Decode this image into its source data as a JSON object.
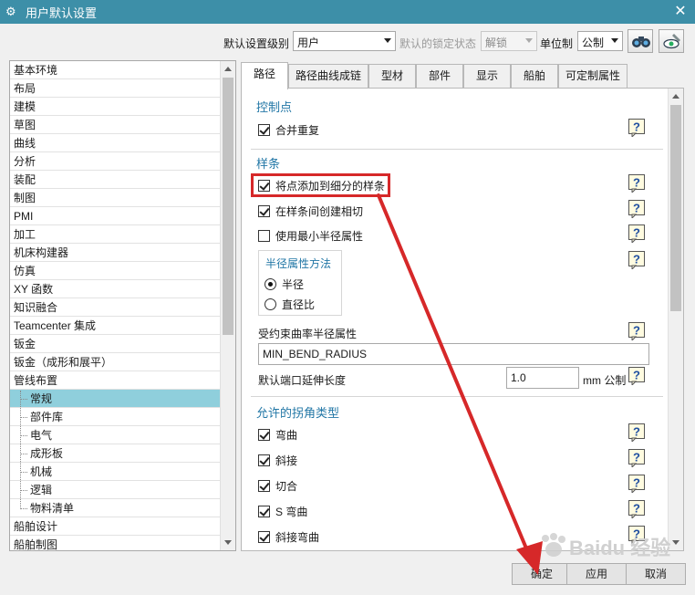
{
  "window": {
    "title": "用户默认设置",
    "close_glyph": "✕"
  },
  "toolbar": {
    "level_label": "默认设置级别",
    "level_value": "用户",
    "lock_label": "默认的锁定状态",
    "lock_value": "解锁",
    "unit_label": "单位制",
    "unit_value": "公制"
  },
  "tree": {
    "items": [
      {
        "label": "基本环境"
      },
      {
        "label": "布局"
      },
      {
        "label": "建模"
      },
      {
        "label": "草图"
      },
      {
        "label": "曲线"
      },
      {
        "label": "分析"
      },
      {
        "label": "装配"
      },
      {
        "label": "制图"
      },
      {
        "label": "PMI"
      },
      {
        "label": "加工"
      },
      {
        "label": "机床构建器"
      },
      {
        "label": "仿真"
      },
      {
        "label": "XY 函数"
      },
      {
        "label": "知识融合"
      },
      {
        "label": "Teamcenter 集成"
      },
      {
        "label": "钣金"
      },
      {
        "label": "钣金（成形和展平）"
      },
      {
        "label": "管线布置"
      },
      {
        "label": "常规"
      },
      {
        "label": "部件库"
      },
      {
        "label": "电气"
      },
      {
        "label": "成形板"
      },
      {
        "label": "机械"
      },
      {
        "label": "逻辑"
      },
      {
        "label": "物料清单"
      },
      {
        "label": "船舶设计"
      },
      {
        "label": "船舶制图"
      }
    ],
    "selected": "常规"
  },
  "tabs": [
    {
      "label": "路径"
    },
    {
      "label": "路径曲线成链"
    },
    {
      "label": "型材"
    },
    {
      "label": "部件"
    },
    {
      "label": "显示"
    },
    {
      "label": "船舶"
    },
    {
      "label": "可定制属性"
    }
  ],
  "panel": {
    "control_points": {
      "header": "控制点",
      "merge_duplicates": {
        "label": "合并重复",
        "checked": true
      }
    },
    "spline": {
      "header": "样条",
      "add_points": {
        "label": "将点添加到细分的样条",
        "checked": true
      },
      "create_tangent": {
        "label": "在样条间创建相切",
        "checked": true
      },
      "use_min_radius": {
        "label": "使用最小半径属性",
        "checked": false
      },
      "radius_method": {
        "header": "半径属性方法",
        "options": [
          {
            "label": "半径",
            "checked": true
          },
          {
            "label": "直径比",
            "checked": false
          }
        ]
      },
      "constrained_label": "受约束曲率半径属性",
      "constrained_value": "MIN_BEND_RADIUS",
      "extension_label": "默认端口延伸长度",
      "extension_value": "1.0",
      "extension_unit": "mm 公制"
    },
    "corners": {
      "header": "允许的拐角类型",
      "items": [
        {
          "label": "弯曲",
          "checked": true
        },
        {
          "label": "斜接",
          "checked": true
        },
        {
          "label": "切合",
          "checked": true
        },
        {
          "label": "S 弯曲",
          "checked": true
        },
        {
          "label": "斜接弯曲",
          "checked": true
        }
      ]
    }
  },
  "buttons": {
    "ok": "确定",
    "apply": "应用",
    "cancel": "取消"
  },
  "watermark": {
    "text": "Baidu 经验"
  },
  "colors": {
    "title_bar": "#3d8fa8",
    "selection": "#8fcfdc",
    "group_header": "#2277a6",
    "annotation_red": "#d62829"
  }
}
